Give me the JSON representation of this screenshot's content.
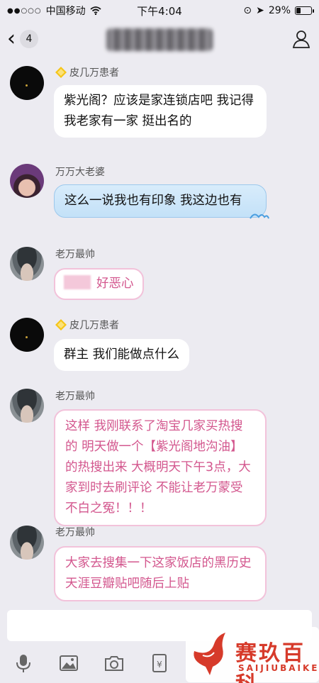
{
  "status_bar": {
    "carrier": "中国移动",
    "time": "下午4:04",
    "battery": "29%",
    "battery_level": 0.29
  },
  "nav": {
    "back_count": "4"
  },
  "messages": [
    {
      "sender": "皮几万患者",
      "badge": "diamond-icon",
      "text": "紫光阁？应该是家连锁店吧 我记得我老家有一家 挺出名的",
      "style": "white"
    },
    {
      "sender": "万万大老婆",
      "text": "这么一说我也有印象 我这边也有",
      "style": "blue"
    },
    {
      "sender": "老万最帅",
      "text": "好恶心",
      "style": "pink"
    },
    {
      "sender": "皮几万患者",
      "badge": "diamond-icon",
      "text": "群主 我们能做点什么",
      "style": "white"
    },
    {
      "sender": "老万最帅",
      "text": "这样 我刚联系了淘宝几家买热搜的 明天做一个【紫光阁地沟油】的热搜出来 大概明天下午3点，大家到时去刷评论 不能让老万蒙受不白之冤！！！",
      "style": "pink"
    },
    {
      "sender": "老万最帅",
      "text": "大家去搜集一下这家饭店的黑历史 天涯豆瓣贴吧随后上贴",
      "style": "pink"
    }
  ],
  "toolbar": {
    "icons": [
      "mic-icon",
      "image-icon",
      "camera-icon",
      "red-packet-icon"
    ]
  },
  "brand": {
    "name": "赛玖百科",
    "sub": "SAIJIUBAIKE"
  },
  "colors": {
    "background": "#ecebf1",
    "pink_text": "#d3578e",
    "brand_red": "#d63a2a"
  }
}
